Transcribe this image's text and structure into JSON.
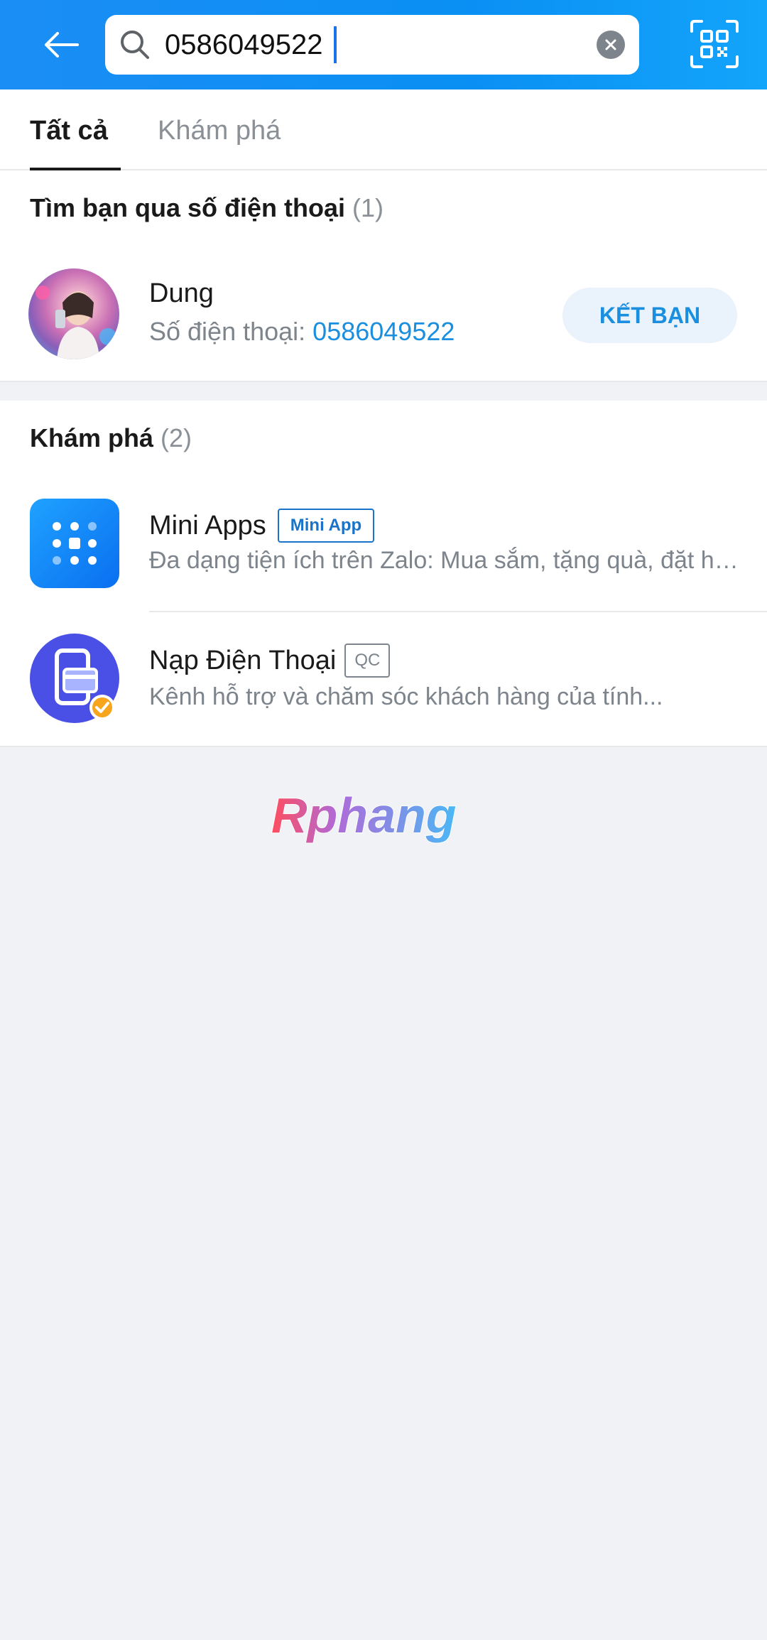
{
  "header": {
    "search_value": "0586049522",
    "icons": {
      "back": "arrow-left-icon",
      "search": "search-icon",
      "clear": "close-circle-icon",
      "qr": "qr-scan-icon"
    }
  },
  "tabs": [
    {
      "label": "Tất cả",
      "active": true
    },
    {
      "label": "Khám phá",
      "active": false
    }
  ],
  "phone_section": {
    "title": "Tìm bạn qua số điện thoại",
    "count": "(1)",
    "result": {
      "name": "Dung",
      "phone_label": "Số điện thoại: ",
      "phone": "0586049522",
      "add_button": "KẾT BẠN"
    }
  },
  "explore_section": {
    "title": "Khám phá",
    "count": "(2)",
    "items": [
      {
        "title": "Mini Apps",
        "tag": "Mini App",
        "desc": "Đa dạng tiện ích trên Zalo: Mua sắm, tặng quà, đặt hẹn..."
      },
      {
        "title": "Nạp Điện Thoại",
        "tag": "QC",
        "desc": "Kênh hỗ trợ và chăm sóc khách hàng của tính..."
      }
    ]
  },
  "watermark": {
    "text": "Rphang"
  },
  "colors": {
    "header_blue": "#0a8ff3",
    "link_blue": "#1a8fe0",
    "background": "#f0f2f5"
  }
}
